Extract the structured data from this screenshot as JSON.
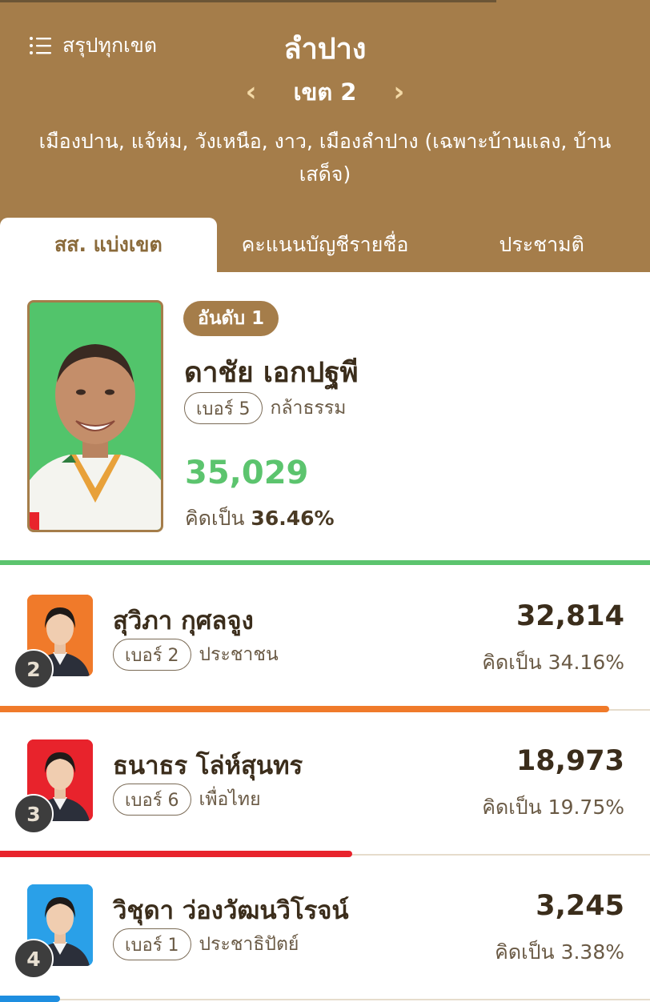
{
  "header": {
    "summary_label": "สรุปทุกเขต",
    "province": "ลำปาง",
    "district": "เขต 2",
    "areas": "เมืองปาน, แจ้ห่ม, วังเหนือ, งาว, เมืองลำปาง (เฉพาะบ้านแลง, บ้านเสด็จ)"
  },
  "tabs": [
    {
      "label": "สส. แบ่งเขต",
      "active": true
    },
    {
      "label": "คะแนนบัญชีรายชื่อ",
      "active": false
    },
    {
      "label": "ประชามติ",
      "active": false
    }
  ],
  "winner": {
    "rank_label": "อันดับ 1",
    "name": "ดาชัย เอกปฐพี",
    "number_label": "เบอร์ 5",
    "party": "กล้าธรรม",
    "votes": "35,029",
    "pct_prefix": "คิดเป็น",
    "pct": "36.46%",
    "bar_color": "#5cc46e"
  },
  "candidates": [
    {
      "rank": "2",
      "name": "สุวิภา กุศลจูง",
      "number_label": "เบอร์ 2",
      "party": "ประชาชน",
      "votes": "32,814",
      "pct_text": "คิดเป็น 34.16%",
      "share": 0.9368,
      "color": "#f07a2a",
      "photo_bg": "#f07a2a"
    },
    {
      "rank": "3",
      "name": "ธนาธร โล่ห์สุนทร",
      "number_label": "เบอร์ 6",
      "party": "เพื่อไทย",
      "votes": "18,973",
      "pct_text": "คิดเป็น 19.75%",
      "share": 0.5417,
      "color": "#e8232c",
      "photo_bg": "#e8232c"
    },
    {
      "rank": "4",
      "name": "วิชุดา ว่องวัฒนวิโรจน์",
      "number_label": "เบอร์ 1",
      "party": "ประชาธิปัตย์",
      "votes": "3,245",
      "pct_text": "คิดเป็น 3.38%",
      "share": 0.0927,
      "color": "#1e8ee0",
      "photo_bg": "#2aa0e8"
    }
  ]
}
